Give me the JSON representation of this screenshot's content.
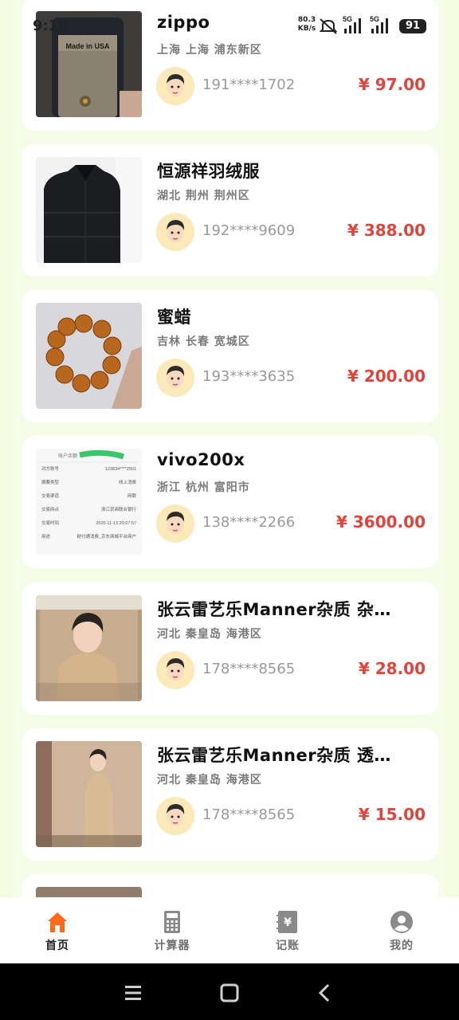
{
  "status_bar": {
    "time": "9:10",
    "net_speed": "80.3",
    "net_unit": "KB/s",
    "sig1": "5G",
    "sig2": "5G",
    "battery": "91"
  },
  "listings": [
    {
      "title": "zippo",
      "location": "上海 上海 浦东新区",
      "phone": "191****1702",
      "price": "¥ 97.00",
      "thumb_text": "Made in USA"
    },
    {
      "title": "恒源祥羽绒服",
      "location": "湖北 荆州 荆州区",
      "phone": "192****9609",
      "price": "¥ 388.00"
    },
    {
      "title": "蜜蜡",
      "location": "吉林 长春 宽城区",
      "phone": "193****3635",
      "price": "¥ 200.00"
    },
    {
      "title": "vivo200x",
      "location": "浙江 杭州 富阳市",
      "phone": "138****2266",
      "price": "¥ 3600.00",
      "receipt": [
        [
          "对方账号",
          "123834****2501"
        ],
        [
          "摘要类型",
          "线上消费"
        ],
        [
          "交易渠道",
          "网联"
        ],
        [
          "交易网点",
          "浙江农商联合银行"
        ],
        [
          "交易时间",
          "2025-11-13 20:07:57"
        ],
        [
          "用途",
          "财付通消费_京东商城平台商户"
        ]
      ],
      "receipt_head": "账户余额"
    },
    {
      "title": "张云雷艺乐Manner杂质  杂…",
      "location": "河北 秦皇岛 海港区",
      "phone": "178****8565",
      "price": "¥ 28.00"
    },
    {
      "title": "张云雷艺乐Manner杂质  透…",
      "location": "河北 秦皇岛 海港区",
      "phone": "178****8565",
      "price": "¥ 15.00"
    }
  ],
  "tabs": [
    {
      "label": "首页",
      "icon": "home-icon",
      "active": true
    },
    {
      "label": "计算器",
      "icon": "calculator-icon"
    },
    {
      "label": "记账",
      "icon": "ledger-icon"
    },
    {
      "label": "我的",
      "icon": "profile-icon"
    }
  ],
  "colors": {
    "accent": "#ff6a1a",
    "price": "#e0443a",
    "background": "#f3fbe1"
  }
}
